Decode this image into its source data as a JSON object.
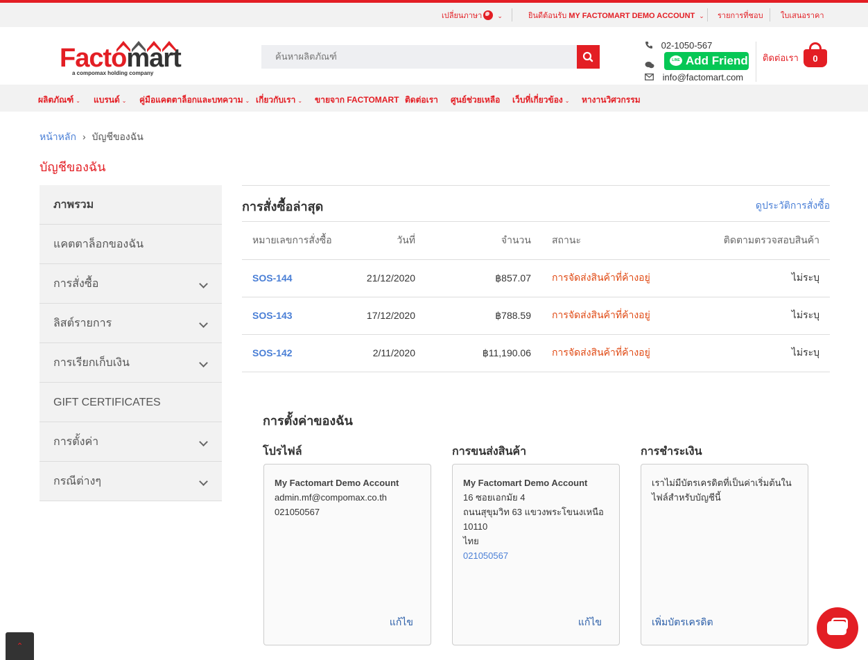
{
  "topbar": {
    "language": "เปลี่ยนภาษา",
    "welcome_prefix": "ยินดีต้อนรับ",
    "account_name": "MY FACTOMART DEMO ACCOUNT",
    "wishlist": "รายการที่ชอบ",
    "quote": "ใบเสนอราคา"
  },
  "header": {
    "logo_text_red": "Facto",
    "logo_text_dark": "mart",
    "logo_sub": "a compomax holding company",
    "search_placeholder": "ค้นหาผลิตภัณฑ์",
    "phone": "02-1050-567",
    "line_button": "Add Friend",
    "email": "info@factomart.com",
    "contact_link": "ติดต่อเรา",
    "cart_count": "0"
  },
  "nav": {
    "items": [
      {
        "label": "ผลิตภัณฑ์",
        "dropdown": true
      },
      {
        "label": "แบรนด์",
        "dropdown": true
      },
      {
        "label": "คู่มือแคตตาล็อกและบทความ",
        "dropdown": true
      },
      {
        "label": "เกี่ยวกับเรา",
        "dropdown": true
      },
      {
        "label": "ขายจาก FACTOMART",
        "dropdown": false
      },
      {
        "label": "ติดต่อเรา",
        "dropdown": false
      },
      {
        "label": "ศูนย์ช่วยเหลือ",
        "dropdown": false
      },
      {
        "label": "เว็บที่เกี่ยวข้อง",
        "dropdown": true
      },
      {
        "label": "หางานวิศวกรรม",
        "dropdown": false
      }
    ]
  },
  "breadcrumb": {
    "home": "หน้าหลัก",
    "current": "บัญชีของฉัน"
  },
  "page_title": "บัญชีของฉัน",
  "sidebar": {
    "items": [
      {
        "label": "ภาพรวม",
        "active": true,
        "chevron": false
      },
      {
        "label": "แคตตาล็อกของฉัน",
        "active": false,
        "chevron": false
      },
      {
        "label": "การสั่งซื้อ",
        "active": false,
        "chevron": true
      },
      {
        "label": "ลิสต์รายการ",
        "active": false,
        "chevron": true
      },
      {
        "label": "การเรียกเก็บเงิน",
        "active": false,
        "chevron": true
      },
      {
        "label": "GIFT CERTIFICATES",
        "active": false,
        "chevron": false
      },
      {
        "label": "การตั้งค่า",
        "active": false,
        "chevron": true
      },
      {
        "label": "กรณีต่างๆ",
        "active": false,
        "chevron": true
      }
    ]
  },
  "orders": {
    "title": "การสั่งซื้อล่าสุด",
    "history_link": "ดูประวัติการสั่งซื้อ",
    "columns": [
      "หมายเลขการสั่งซื้อ",
      "วันที่",
      "จำนวน",
      "สถานะ",
      "ติดตามตรวจสอบสินค้า"
    ],
    "rows": [
      {
        "id": "SOS-144",
        "date": "21/12/2020",
        "amount": "฿857.07",
        "status": "การจัดส่งสินค้าที่ค้างอยู่",
        "tracking": "ไม่ระบุ"
      },
      {
        "id": "SOS-143",
        "date": "17/12/2020",
        "amount": "฿788.59",
        "status": "การจัดส่งสินค้าที่ค้างอยู่",
        "tracking": "ไม่ระบุ"
      },
      {
        "id": "SOS-142",
        "date": "2/11/2020",
        "amount": "฿11,190.06",
        "status": "การจัดส่งสินค้าที่ค้างอยู่",
        "tracking": "ไม่ระบุ"
      }
    ]
  },
  "settings": {
    "title": "การตั้งค่าของฉัน",
    "profile": {
      "heading": "โปรไฟล์",
      "name": "My Factomart Demo Account",
      "email": "admin.mf@compomax.co.th",
      "phone": "021050567",
      "edit": "แก้ไข"
    },
    "shipping": {
      "heading": "การขนส่งสินค้า",
      "name": "My Factomart Demo Account",
      "line1": "16 ซอยเอกมัย 4",
      "line2": "ถนนสุขุมวิท 63 แขวงพระโขนงเหนือ",
      "line3": "10110",
      "country": "ไทย",
      "phone": "021050567",
      "edit": "แก้ไข"
    },
    "payment": {
      "heading": "การชำระเงิน",
      "message": "เราไม่มีบัตรเครดิตที่เป็นค่าเริ่มต้นในไฟล์สำหรับบัญชีนี้",
      "add": "เพิ่มบัตรเครดิต"
    }
  },
  "colors": {
    "brand_red": "#e31e24",
    "link_blue": "#4a7fd6",
    "status_orange": "#e04a14",
    "line_green": "#06c755"
  },
  "icons": {
    "search": "search-icon",
    "phone": "phone-icon",
    "chat": "chat-icon",
    "mail": "mail-icon",
    "cart": "cart-icon",
    "globe": "globe-icon",
    "scroll_top": "chevron-up-icon"
  }
}
